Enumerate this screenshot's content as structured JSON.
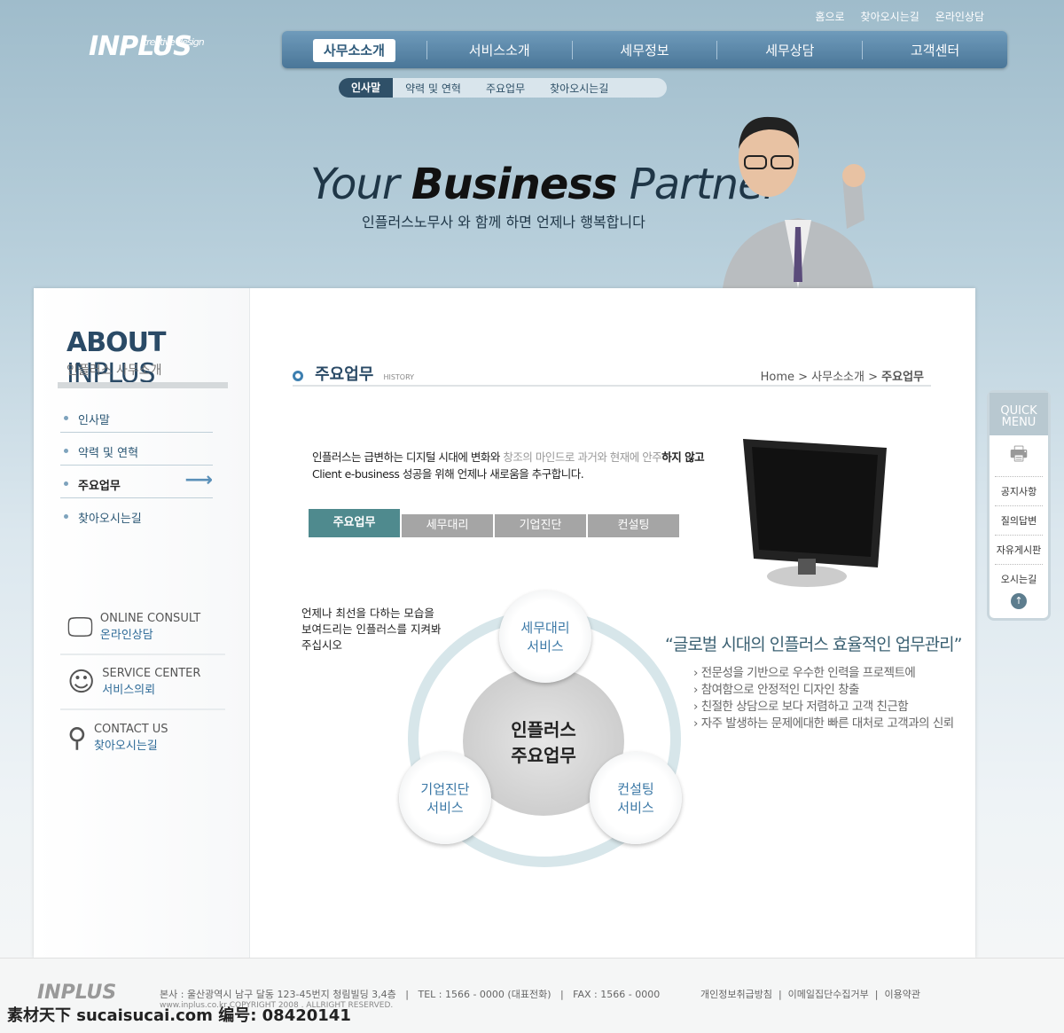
{
  "util": [
    "홈으로",
    "찾아오시는길",
    "온라인상담"
  ],
  "logo": {
    "text": "INPLUS",
    "tag": "creative design"
  },
  "gnb": [
    "사무소소개",
    "서비스소개",
    "세무정보",
    "세무상담",
    "고객센터"
  ],
  "subnav": [
    "인사말",
    "약력 및 연혁",
    "주요업무",
    "찾아오시는길"
  ],
  "hero": {
    "a": "Your ",
    "b": "Business",
    "c": " Partner",
    "sub": "인플러스노무사 와 함께 하면 언제나 행복합니다"
  },
  "side": {
    "title_a": "ABOUT",
    "title_b": " INPLUS",
    "subtitle": "인플러스 사무소개",
    "menu": [
      "인사말",
      "약력 및 연혁",
      "주요업무",
      "찾아오시는길"
    ],
    "banners": [
      {
        "en": "ONLINE CONSULT",
        "ko": "온라인상담",
        "icon": "monitor-search-icon"
      },
      {
        "en": "SERVICE CENTER",
        "ko": "서비스의뢰",
        "icon": "speaking-face-icon"
      },
      {
        "en": "CONTACT US",
        "ko": "찾아오시는길",
        "icon": "magnifier-icon"
      }
    ]
  },
  "content": {
    "title": "주요업무",
    "title_en": "HISTORY",
    "breadcrumb": [
      "Home",
      "사무소소개",
      "주요업무"
    ],
    "intro1a": "인플러스는 급변하는 디지털 시대에 변화와 ",
    "intro1b": "창조의 마인드로 과거와 현재에 안주",
    "intro1c": "하지 않고",
    "intro2": "Client e-business  성공을 위해 언제나 새로움을 추구합니다.",
    "tabs": [
      "주요업무",
      "세무대리",
      "기업진단",
      "컨설팅"
    ],
    "note": "언제나 최선을 다하는 모습을 보여드리는 인플러스를 지켜봐주십시오",
    "center": [
      "인플러스",
      "주요업무"
    ],
    "nodes": [
      [
        "세무대리",
        "서비스"
      ],
      [
        "기업진단",
        "서비스"
      ],
      [
        "컨설팅",
        "서비스"
      ]
    ],
    "quote": "“글로벌 시대의 인플러스 효율적인 업무관리”",
    "bullets": [
      "전문성을 기반으로 우수한 인력을 프로젝트에",
      "참여함으로 안정적인 디자인 창출",
      "친절한 상담으로 보다 저렴하고 고객 친근함",
      "자주 발생하는 문제에대한 빠른 대처로 고객과의 신뢰"
    ]
  },
  "quick": {
    "title": "QUICK MENU",
    "items": [
      "공지사항",
      "질의답변",
      "자유게시판",
      "오시는길"
    ]
  },
  "footer": {
    "address": "본사 : 울산광역시 남구 달동 123-45번지 청림빌딩 3,4층   |   TEL : 1566 - 0000 (대표전화)   |   FAX : 1566 - 0000",
    "copy": "www.inplus.co.kr COPYRIGHT 2008 . ALLRIGHT RESERVED.",
    "links": [
      "개인정보취급방침",
      "이메일집단수집거부",
      "이용약관"
    ],
    "watermark": "素材天下 sucaisucai.com  编号: 08420141"
  }
}
